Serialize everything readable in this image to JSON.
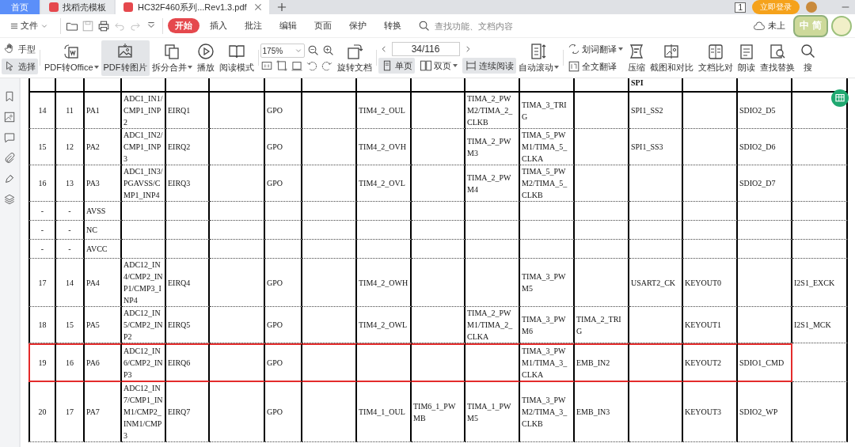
{
  "tabs": [
    {
      "kind": "home",
      "label": "首页",
      "selected": false
    },
    {
      "kind": "template",
      "label": "找稻壳模板",
      "selected": false
    },
    {
      "kind": "pdf",
      "label": "HC32F460系列...Rev1.3.pdf",
      "selected": true
    }
  ],
  "title_bar": {
    "device_badge": "1",
    "login": "立即登录"
  },
  "promo": {
    "line_1": "中",
    "line_2": "简"
  },
  "menu": {
    "file": "文件",
    "tabs": [
      {
        "label": "开始",
        "selected": true
      },
      {
        "label": "插入",
        "selected": false
      },
      {
        "label": "批注",
        "selected": false
      },
      {
        "label": "编辑",
        "selected": false
      },
      {
        "label": "页面",
        "selected": false
      },
      {
        "label": "保护",
        "selected": false
      },
      {
        "label": "转换",
        "selected": false
      }
    ],
    "search_placeholder": "查找功能、文档内容",
    "cloud_status": "未上"
  },
  "toolbar": {
    "modes": [
      {
        "kind": "hand",
        "label": "手型",
        "selected": false
      },
      {
        "kind": "select",
        "label": "选择",
        "selected": true
      }
    ],
    "main_buttons": [
      {
        "kind": "pdf-office",
        "label": "PDF转Office",
        "dropdown": true,
        "selected": false
      },
      {
        "kind": "pdf-image",
        "label": "PDF转图片",
        "dropdown": false,
        "selected": true
      },
      {
        "kind": "split",
        "label": "拆分合并",
        "dropdown": true,
        "selected": false
      },
      {
        "kind": "play",
        "label": "播放",
        "dropdown": false,
        "selected": false
      },
      {
        "kind": "book",
        "label": "阅读模式",
        "dropdown": false,
        "selected": false
      }
    ],
    "zoom": "175%",
    "rotate": {
      "kind": "rotate",
      "label": "旋转文档",
      "dropdown": false,
      "selected": false
    },
    "page": "34/116",
    "view_modes": [
      {
        "kind": "single",
        "label": "单页",
        "dropdown": false,
        "selected": true
      },
      {
        "kind": "double",
        "label": "双页",
        "dropdown": true,
        "selected": false
      },
      {
        "kind": "continuous",
        "label": "连续阅读",
        "dropdown": false,
        "selected": true
      }
    ],
    "auto_scroll": {
      "kind": "scroll",
      "label": "自动滚动",
      "dropdown": true,
      "selected": false
    },
    "translate": [
      {
        "kind": "word-translate",
        "label": "划词翻译",
        "dropdown": true
      },
      {
        "kind": "full-translate",
        "label": "全文翻译",
        "dropdown": false
      }
    ],
    "tools": [
      {
        "kind": "compress",
        "label": "压缩",
        "dropdown": false,
        "selected": false
      },
      {
        "kind": "screenshot",
        "label": "截图和对比",
        "dropdown": false,
        "selected": false
      },
      {
        "kind": "compare",
        "label": "文档比对",
        "dropdown": false,
        "selected": false
      },
      {
        "kind": "read",
        "label": "朗读",
        "dropdown": false,
        "selected": false
      },
      {
        "kind": "find",
        "label": "查找替换",
        "dropdown": false,
        "selected": false
      },
      {
        "kind": "search",
        "label": "搜",
        "dropdown": false,
        "selected": false
      }
    ]
  },
  "table": {
    "header_cells": [
      null,
      null,
      null,
      null,
      null,
      null,
      null,
      null,
      null,
      null,
      null,
      null,
      null,
      "SPI",
      null,
      null,
      null
    ],
    "rows": [
      {
        "highlighted": false,
        "cells": [
          "14",
          "11",
          "PA1",
          "ADC1_IN1/CMP1_INP2",
          "EIRQ1",
          null,
          "GPO",
          null,
          "TIM4_2_OUL",
          null,
          "TIMA_2_PWM2/TIMA_2_CLKB",
          "TIMA_3_TRIG",
          null,
          "SPI1_SS2",
          null,
          "SDIO2_D5",
          null
        ]
      },
      {
        "highlighted": false,
        "cells": [
          "15",
          "12",
          "PA2",
          "ADC1_IN2/CMP1_INP3",
          "EIRQ2",
          null,
          "GPO",
          null,
          "TIM4_2_OVH",
          null,
          "TIMA_2_PWM3",
          "TIMA_5_PWM1/TIMA_5_CLKA",
          null,
          "SPI1_SS3",
          null,
          "SDIO2_D6",
          null
        ]
      },
      {
        "highlighted": false,
        "cells": [
          "16",
          "13",
          "PA3",
          "ADC1_IN3/PGAVSS/CMP1_INP4",
          "EIRQ3",
          null,
          "GPO",
          null,
          "TIM4_2_OVL",
          null,
          "TIMA_2_PWM4",
          "TIMA_5_PWM2/TIMA_5_CLKB",
          null,
          null,
          null,
          "SDIO2_D7",
          null
        ]
      },
      {
        "highlighted": false,
        "cells": [
          "-",
          "-",
          "AVSS",
          null,
          null,
          null,
          null,
          null,
          null,
          null,
          null,
          null,
          null,
          null,
          null,
          null,
          null
        ]
      },
      {
        "highlighted": false,
        "cells": [
          "-",
          "-",
          "NC",
          null,
          null,
          null,
          null,
          null,
          null,
          null,
          null,
          null,
          null,
          null,
          null,
          null,
          null
        ]
      },
      {
        "highlighted": false,
        "cells": [
          "-",
          "-",
          "AVCC",
          null,
          null,
          null,
          null,
          null,
          null,
          null,
          null,
          null,
          null,
          null,
          null,
          null,
          null
        ]
      },
      {
        "highlighted": false,
        "cells": [
          "17",
          "14",
          "PA4",
          "ADC12_IN4/CMP2_INP1/CMP3_INP4",
          "EIRQ4",
          null,
          "GPO",
          null,
          "TIM4_2_OWH",
          null,
          null,
          "TIMA_3_PWM5",
          null,
          "USART2_CK",
          "KEYOUT0",
          null,
          "I2S1_EXCK"
        ]
      },
      {
        "highlighted": false,
        "cells": [
          "18",
          "15",
          "PA5",
          "ADC12_IN5/CMP2_INP2",
          "EIRQ5",
          null,
          "GPO",
          null,
          "TIM4_2_OWL",
          null,
          "TIMA_2_PWM1/TIMA_2_CLKA",
          "TIMA_3_PWM6",
          "TIMA_2_TRIG",
          null,
          "KEYOUT1",
          null,
          "I2S1_MCK"
        ]
      },
      {
        "highlighted": true,
        "cells": [
          "19",
          "16",
          "PA6",
          "ADC12_IN6/CMP2_INP3",
          "EIRQ6",
          null,
          "GPO",
          null,
          null,
          null,
          null,
          "TIMA_3_PWM1/TIMA_3_CLKA",
          "EMB_IN2",
          null,
          "KEYOUT2",
          "SDIO1_CMD",
          null
        ]
      },
      {
        "highlighted": false,
        "cells": [
          "20",
          "17",
          "PA7",
          "ADC12_IN7/CMP1_INM1/CMP2_INM1/CMP3",
          "EIRQ7",
          null,
          "GPO",
          null,
          "TIM4_1_OUL",
          "TIM6_1_PWMB",
          "TIMA_1_PWM5",
          "TIMA_3_PWM2/TIMA_3_CLKB",
          "EMB_IN3",
          null,
          "KEYOUT3",
          "SDIO2_WP",
          null
        ]
      }
    ]
  }
}
